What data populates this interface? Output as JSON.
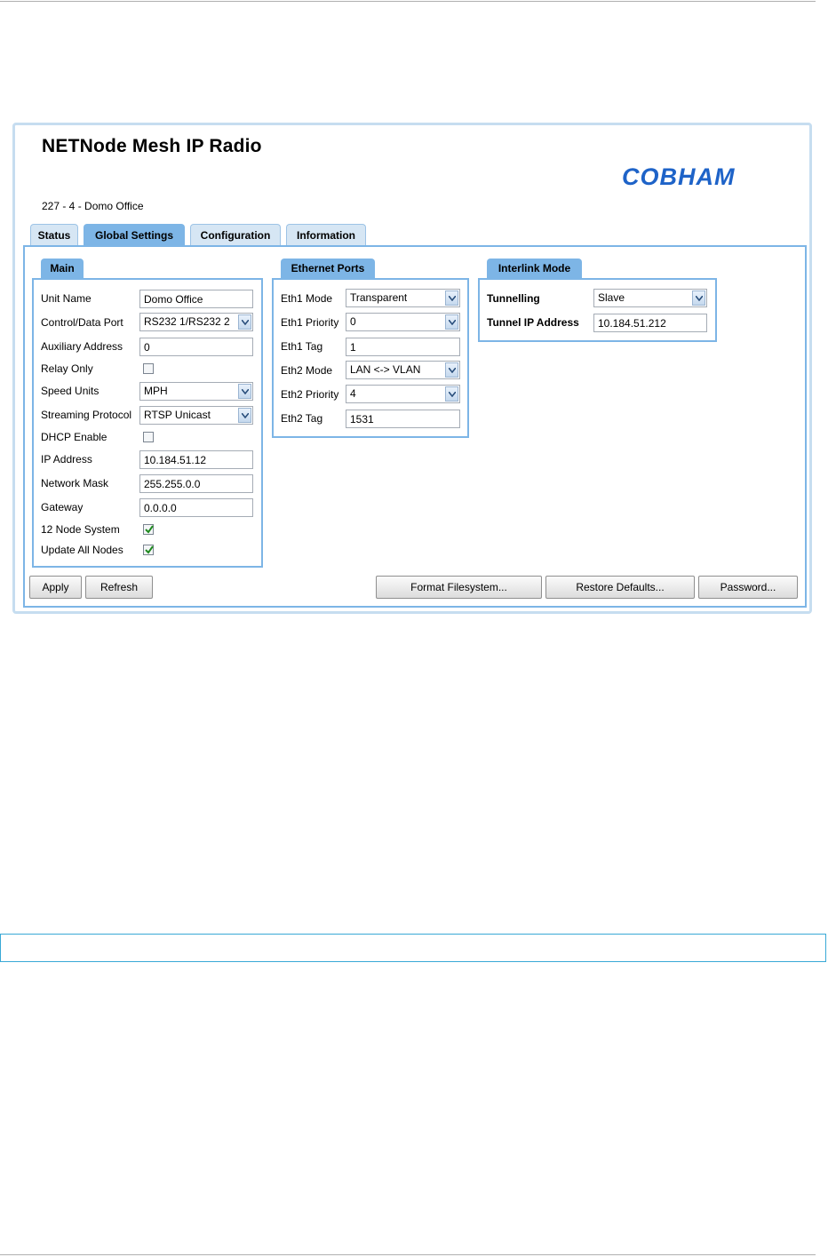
{
  "app": {
    "title": "NETNode Mesh IP Radio",
    "device": "227 - 4 - Domo Office",
    "logo_text": "COBHAM",
    "brand_color": "#1e63c8",
    "accent_color": "#7db5e6"
  },
  "tabs": [
    {
      "label": "Status",
      "active": false
    },
    {
      "label": "Global Settings",
      "active": true
    },
    {
      "label": "Configuration",
      "active": false
    },
    {
      "label": "Information",
      "active": false
    }
  ],
  "main": {
    "title": "Main",
    "unit_name": {
      "label": "Unit Name",
      "value": "Domo Office"
    },
    "control_port": {
      "label": "Control/Data Port",
      "value": "RS232 1/RS232 2"
    },
    "aux_address": {
      "label": "Auxiliary Address",
      "value": "0"
    },
    "relay_only": {
      "label": "Relay Only",
      "checked": false
    },
    "speed_units": {
      "label": "Speed Units",
      "value": "MPH"
    },
    "streaming": {
      "label": "Streaming Protocol",
      "value": "RTSP Unicast"
    },
    "dhcp": {
      "label": "DHCP Enable",
      "checked": false
    },
    "ip": {
      "label": "IP Address",
      "value": "10.184.51.12"
    },
    "mask": {
      "label": "Network Mask",
      "value": "255.255.0.0"
    },
    "gateway": {
      "label": "Gateway",
      "value": "0.0.0.0"
    },
    "node12": {
      "label": "12 Node System",
      "checked": true
    },
    "update_all": {
      "label": "Update All Nodes",
      "checked": true
    }
  },
  "ethernet": {
    "title": "Ethernet Ports",
    "eth1_mode": {
      "label": "Eth1 Mode",
      "value": "Transparent"
    },
    "eth1_priority": {
      "label": "Eth1 Priority",
      "value": "0"
    },
    "eth1_tag": {
      "label": "Eth1 Tag",
      "value": "1"
    },
    "eth2_mode": {
      "label": "Eth2 Mode",
      "value": "LAN <-> VLAN"
    },
    "eth2_priority": {
      "label": "Eth2 Priority",
      "value": "4"
    },
    "eth2_tag": {
      "label": "Eth2 Tag",
      "value": "1531"
    }
  },
  "interlink": {
    "title": "Interlink Mode",
    "tunnelling": {
      "label": "Tunnelling",
      "value": "Slave"
    },
    "tunnel_ip": {
      "label": "Tunnel IP Address",
      "value": "10.184.51.212"
    }
  },
  "buttons": {
    "apply": "Apply",
    "refresh": "Refresh",
    "format": "Format Filesystem...",
    "restore": "Restore Defaults...",
    "password": "Password..."
  },
  "icons": {
    "dropdown": "chevron-down-icon",
    "check": "checkmark-icon"
  }
}
